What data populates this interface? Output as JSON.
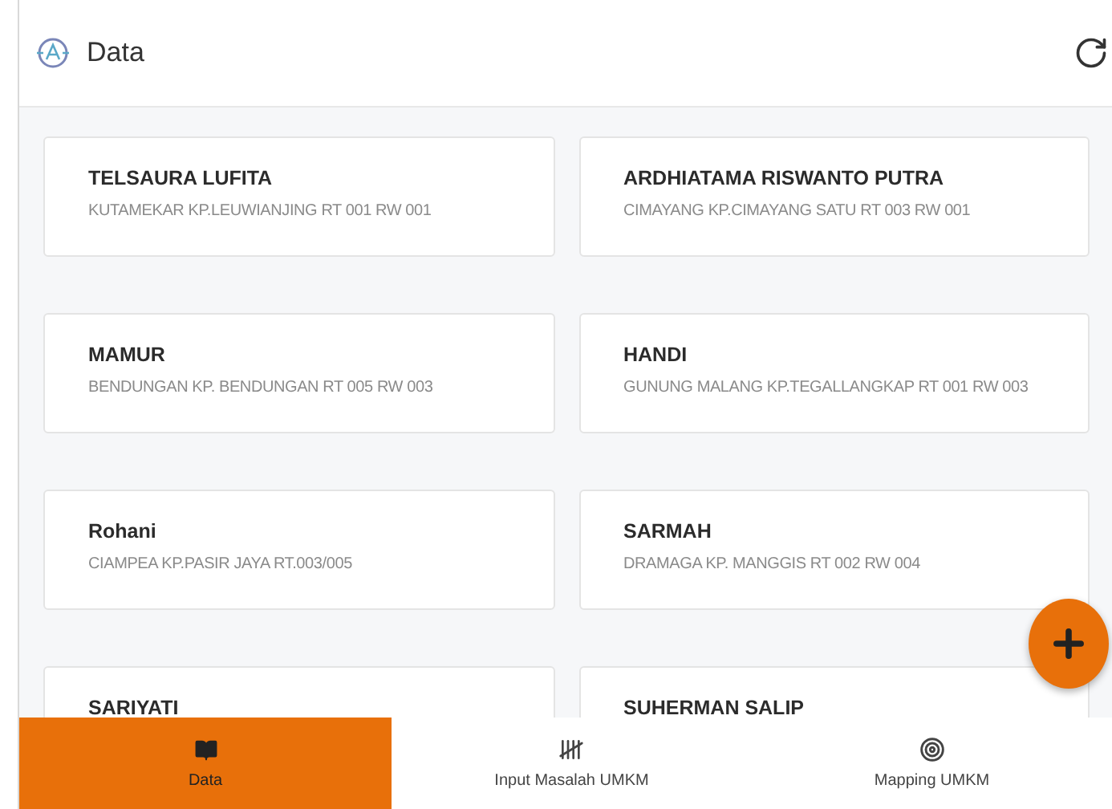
{
  "header": {
    "title": "Data"
  },
  "records": [
    {
      "name": "TELSAURA LUFITA",
      "address": "KUTAMEKAR KP.LEUWIANJING RT 001 RW 001"
    },
    {
      "name": "ARDHIATAMA RISWANTO PUTRA",
      "address": "CIMAYANG KP.CIMAYANG SATU RT 003 RW 001"
    },
    {
      "name": "MAMUR",
      "address": "BENDUNGAN KP. BENDUNGAN RT 005 RW 003"
    },
    {
      "name": "HANDI",
      "address": "GUNUNG MALANG KP.TEGALLANGKAP RT 001 RW 003"
    },
    {
      "name": "Rohani",
      "address": "CIAMPEA KP.PASIR JAYA RT.003/005"
    },
    {
      "name": "SARMAH",
      "address": "DRAMAGA KP. MANGGIS RT 002 RW 004"
    },
    {
      "name": "SARIYATI"
    },
    {
      "name": "SUHERMAN SALIP"
    }
  ],
  "nav": [
    {
      "label": "Data",
      "kind": "book",
      "selected": true
    },
    {
      "label": "Input Masalah UMKM",
      "kind": "tally",
      "selected": false
    },
    {
      "label": "Mapping UMKM",
      "kind": "target",
      "selected": false
    }
  ]
}
